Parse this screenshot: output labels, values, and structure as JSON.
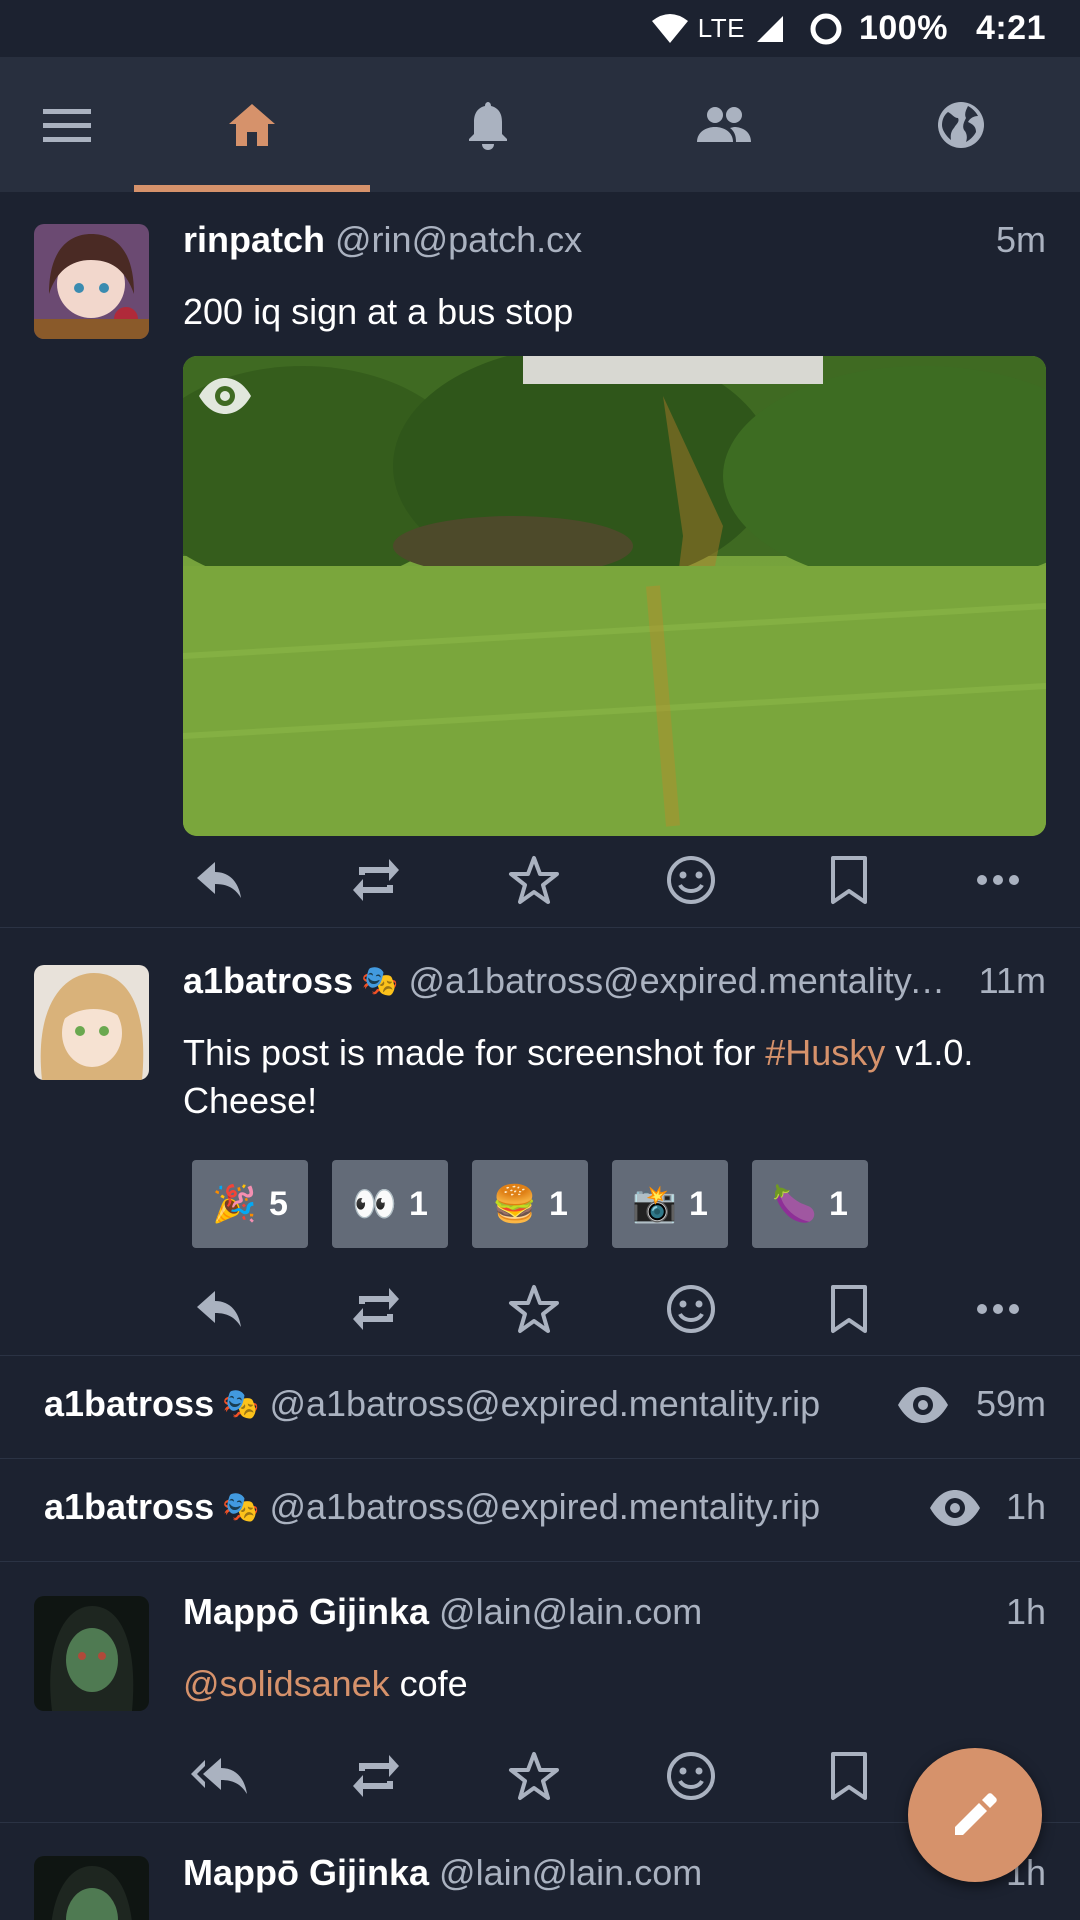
{
  "status_bar": {
    "network": "LTE",
    "battery": "100%",
    "time": "4:21"
  },
  "toolbar": {
    "menu_icon": "hamburger-menu-icon",
    "tabs": [
      {
        "icon": "home-icon",
        "active": true
      },
      {
        "icon": "bell-icon",
        "active": false
      },
      {
        "icon": "people-icon",
        "active": false
      },
      {
        "icon": "globe-icon",
        "active": false
      }
    ]
  },
  "colors": {
    "accent": "#d6926b",
    "background": "#1c2230",
    "toolbar": "#282f3e",
    "secondary_text": "#aab2c0"
  },
  "posts": [
    {
      "name": "rinpatch",
      "handle": "@rin@patch.cx",
      "time": "5m",
      "text": "200 iq sign at a bus stop",
      "media": {
        "type": "image",
        "sensitive_toggle_icon": "eye-icon"
      }
    },
    {
      "name": "a1batross",
      "name_emoji": "🎭",
      "handle": "@a1batross@expired.mentality.…",
      "time": "11m",
      "text_before": "This post is made for screenshot for ",
      "hashtag": "#Husky",
      "text_after": " v1.0. Cheese!",
      "reactions": [
        {
          "emoji": "🎉",
          "count": "5"
        },
        {
          "emoji": "👀",
          "count": "1"
        },
        {
          "emoji": "🍔",
          "count": "1"
        },
        {
          "emoji": "📸",
          "count": "1"
        },
        {
          "emoji": "🍆",
          "count": "1"
        }
      ]
    },
    {
      "name": "Mappō Gijinka",
      "handle": "@lain@lain.com",
      "time": "1h",
      "mention": "@solidsanek",
      "text": " cofe"
    },
    {
      "name": "Mappō Gijinka",
      "handle": "@lain@lain.com",
      "time": "1h"
    }
  ],
  "collapsed": [
    {
      "name": "a1batross",
      "name_emoji": "🎭",
      "handle": "@a1batross@expired.mentality.rip",
      "time": "59m"
    },
    {
      "name": "a1batross",
      "name_emoji": "🎭",
      "handle": "@a1batross@expired.mentality.rip",
      "time": "1h"
    }
  ],
  "actions": [
    "reply-icon",
    "boost-icon",
    "favourite-icon",
    "emoji-react-icon",
    "bookmark-icon",
    "more-icon"
  ],
  "fab": {
    "icon": "pencil-icon"
  }
}
